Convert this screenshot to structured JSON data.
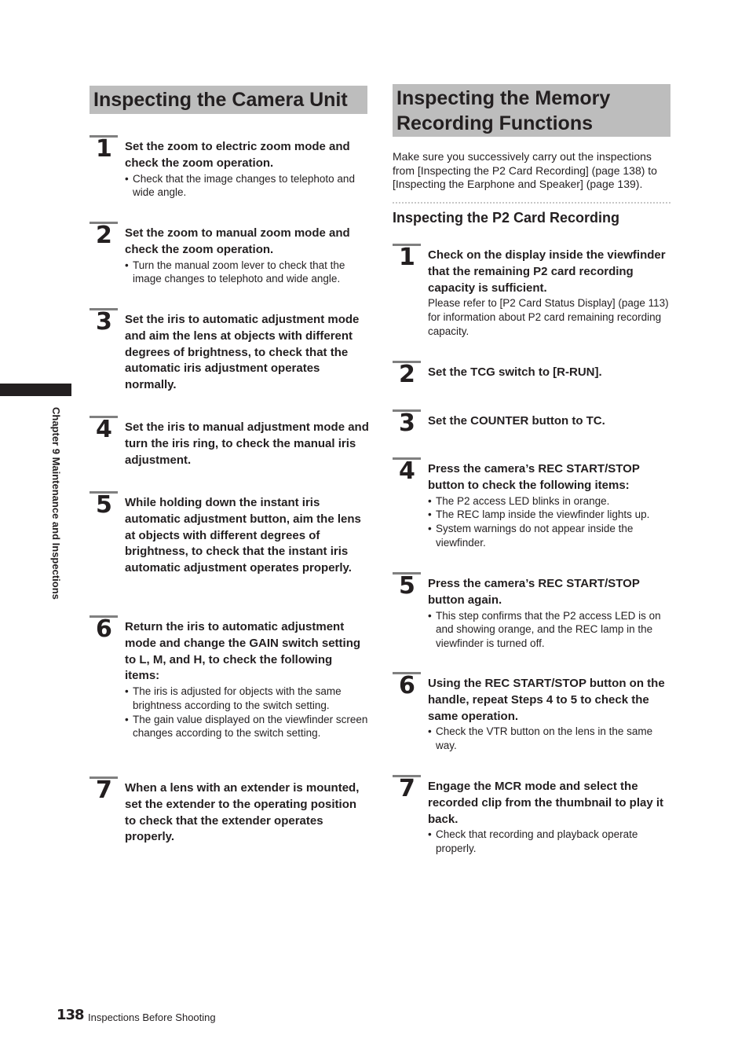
{
  "sidebar": {
    "chapter_label": "Chapter 9  Maintenance and Inspections"
  },
  "left_section": {
    "title": "Inspecting the Camera Unit",
    "steps": [
      {
        "number": "1",
        "heading": "Set the zoom to electric zoom mode and check the zoom operation.",
        "bullets": [
          "Check that the image changes to telephoto and wide angle."
        ]
      },
      {
        "number": "2",
        "heading": "Set the zoom to manual zoom mode and check the zoom operation.",
        "bullets": [
          "Turn the manual zoom lever to check that the image changes to telephoto and wide angle."
        ]
      },
      {
        "number": "3",
        "heading": "Set the iris to automatic adjustment mode and aim the lens at objects with different degrees of brightness, to check that the automatic iris adjustment operates normally."
      },
      {
        "number": "4",
        "heading": "Set the iris to manual adjustment mode and turn the iris ring, to check the manual iris adjustment."
      },
      {
        "number": "5",
        "heading": "While holding down the instant iris automatic adjustment button, aim the lens at objects with different degrees of brightness, to check that the instant iris automatic adjustment operates properly."
      },
      {
        "number": "6",
        "heading": "Return the iris to automatic adjustment mode and change the GAIN switch setting to L, M, and H, to check the following items:",
        "bullets": [
          "The iris is adjusted for objects with the same brightness according to the switch setting.",
          "The gain value displayed on the viewfinder screen changes according to the switch setting."
        ]
      },
      {
        "number": "7",
        "heading": "When a lens with an extender is mounted, set the extender to the operating position to check that the extender operates properly."
      }
    ]
  },
  "right_section": {
    "title": "Inspecting the Memory Recording Functions",
    "intro": "Make sure you successively carry out the inspections from [Inspecting the P2 Card Recording] (page 138) to [Inspecting the Earphone and Speaker] (page 139).",
    "subheading": "Inspecting the P2 Card Recording",
    "steps": [
      {
        "number": "1",
        "heading": "Check on the display inside the viewfinder that the remaining P2 card recording capacity is sufficient.",
        "note": "Please refer to [P2 Card Status Display] (page 113) for information about P2 card remaining recording capacity."
      },
      {
        "number": "2",
        "heading": "Set the TCG switch to [R-RUN]."
      },
      {
        "number": "3",
        "heading": "Set the COUNTER button to TC."
      },
      {
        "number": "4",
        "heading": "Press the camera’s REC START/STOP button to check the following items:",
        "bullets": [
          "The P2 access LED blinks in orange.",
          "The REC lamp inside the viewfinder lights up.",
          "System warnings do not appear inside the viewfinder."
        ]
      },
      {
        "number": "5",
        "heading": "Press the camera’s REC START/STOP button again.",
        "bullets": [
          "This step confirms that the P2 access LED is on and showing orange, and the REC lamp in the viewfinder is turned off."
        ]
      },
      {
        "number": "6",
        "heading": "Using the REC START/STOP button on the handle, repeat Steps 4 to 5 to check the same operation.",
        "bullets": [
          "Check the VTR button on the lens in the same way."
        ]
      },
      {
        "number": "7",
        "heading": "Engage the MCR mode and select the recorded clip from the thumbnail to play it back.",
        "bullets": [
          "Check that recording and playback operate properly."
        ]
      }
    ]
  },
  "footer": {
    "page_number": "138",
    "section_name": "Inspections Before Shooting"
  }
}
